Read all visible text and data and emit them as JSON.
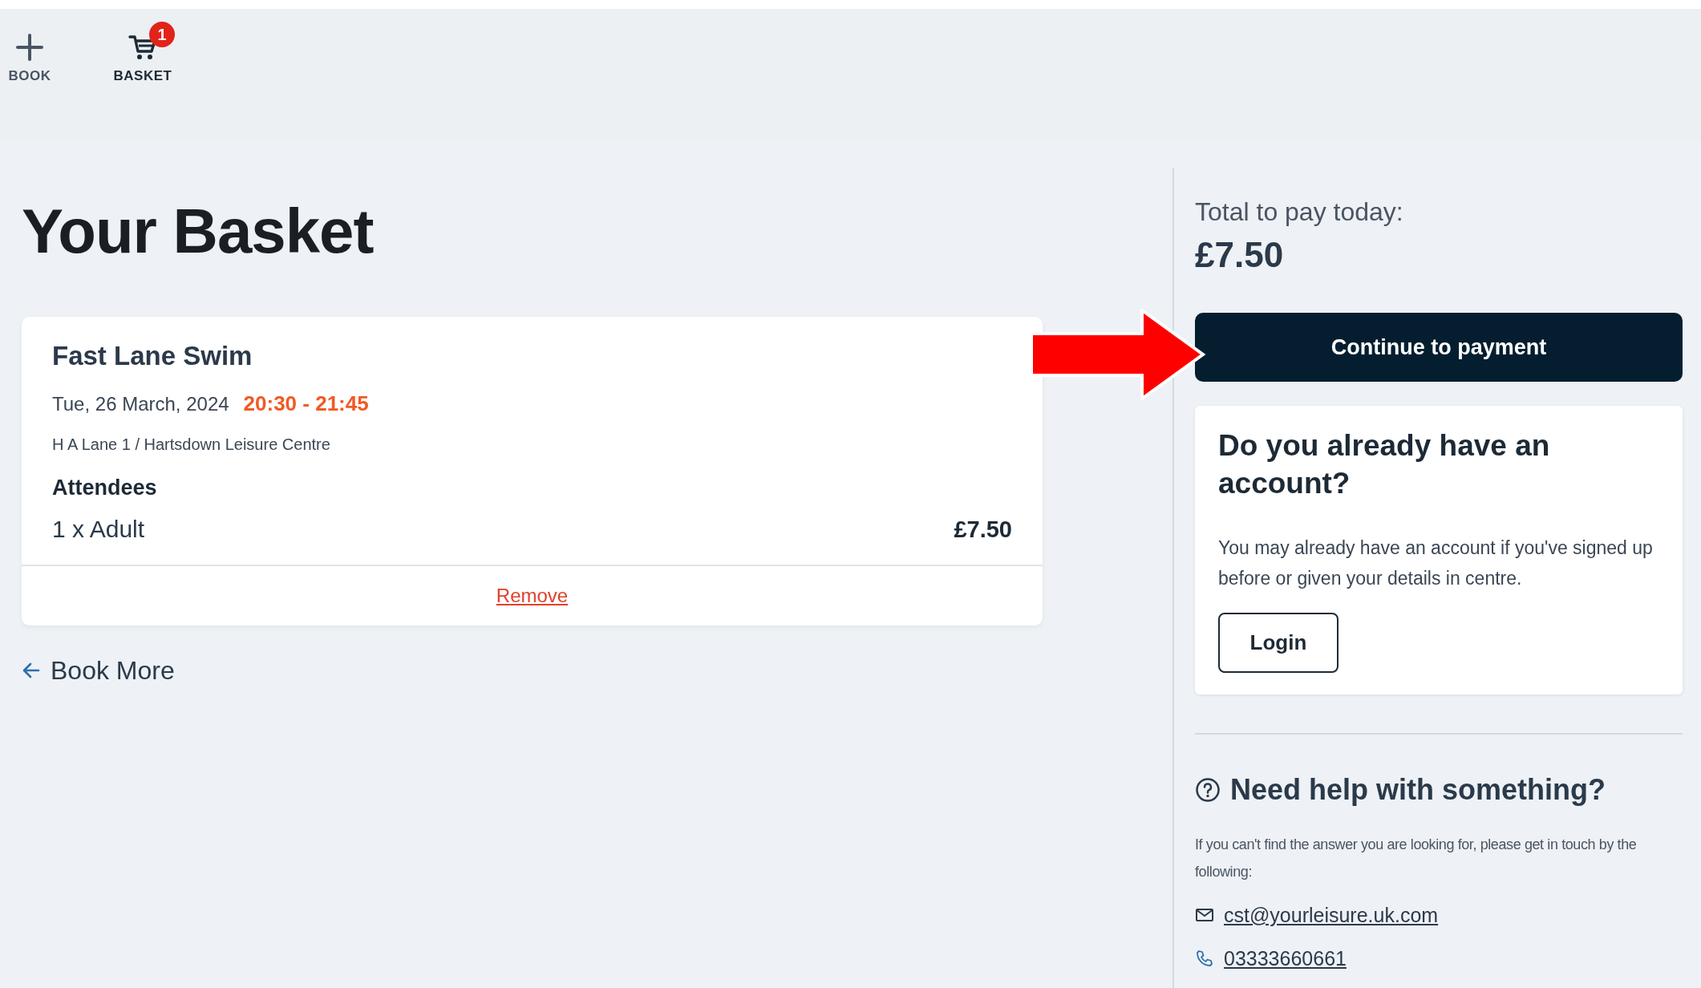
{
  "nav": [
    {
      "kind": "plus",
      "label": "BOOK"
    },
    {
      "kind": "cart",
      "label": "BASKET",
      "badge": "1"
    }
  ],
  "page_title": "Your Basket",
  "basket_items": [
    {
      "name": "Fast Lane Swim",
      "date": "Tue, 26 March, 2024",
      "time": "20:30 - 21:45",
      "location": "H A Lane 1 / Hartsdown Leisure Centre",
      "attendees_heading": "Attendees",
      "attendees": [
        {
          "label": "1 x Adult",
          "price": "£7.50"
        }
      ],
      "remove": "Remove"
    }
  ],
  "book_more": "Book More",
  "summary": {
    "total_label": "Total to pay today:",
    "total": "£7.50",
    "continue_button": "Continue to payment"
  },
  "account": {
    "heading": "Do you already have an account?",
    "text": "You may already have an account if you've signed up before or given your details in centre.",
    "button": "Login"
  },
  "help": {
    "heading": "Need help with something?",
    "text": "If you can't find the answer you are looking for, please get in touch by the following:",
    "contacts": [
      {
        "kind": "email",
        "text": "cst@yourleisure.uk.com"
      },
      {
        "kind": "phone",
        "text": "03333660661"
      }
    ]
  }
}
